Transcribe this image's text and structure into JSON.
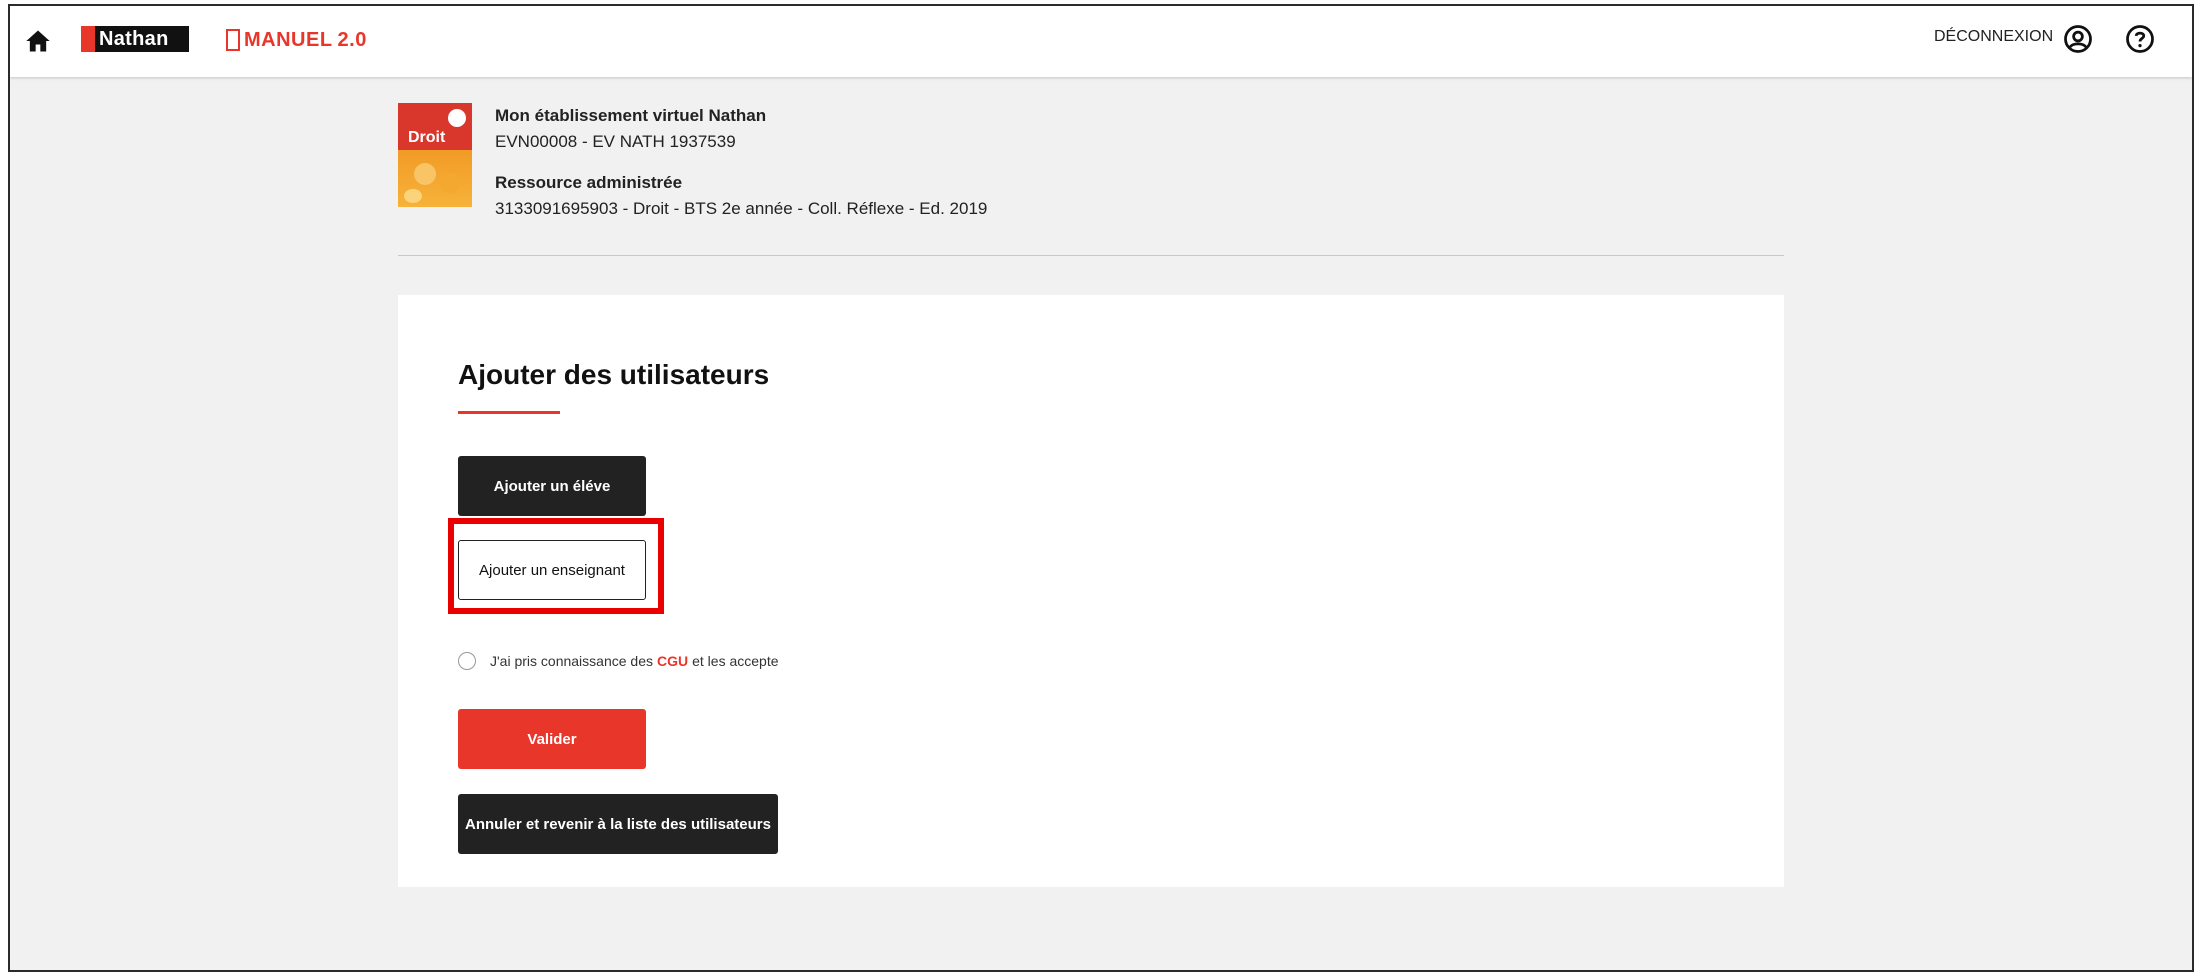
{
  "topbar": {
    "nathan_logo": "Nathan",
    "emanuel_logo": "MANUEL",
    "emanuel_version": "2.0",
    "logout_label": "DÉCONNEXION"
  },
  "resource": {
    "establishment_title": "Mon établissement virtuel Nathan",
    "establishment_id": "EVN00008 - EV NATH 1937539",
    "resource_title": "Ressource administrée",
    "resource_detail": "3133091695903 - Droit - BTS 2e année - Coll. Réflexe - Ed. 2019",
    "cover_title": "Droit"
  },
  "form": {
    "title": "Ajouter des utilisateurs",
    "add_student_label": "Ajouter un éléve",
    "add_teacher_label": "Ajouter un enseignant",
    "cgu_prefix": "J'ai pris connaissance des",
    "cgu_link": "CGU",
    "cgu_suffix": "et les accepte",
    "validate_label": "Valider",
    "cancel_label": "Annuler et revenir à la liste des utilisateurs"
  },
  "colors": {
    "accent": "#e8362a",
    "dark": "#222222",
    "highlight": "#ea0000"
  },
  "icons": [
    "home-icon",
    "account-icon",
    "help-icon"
  ]
}
